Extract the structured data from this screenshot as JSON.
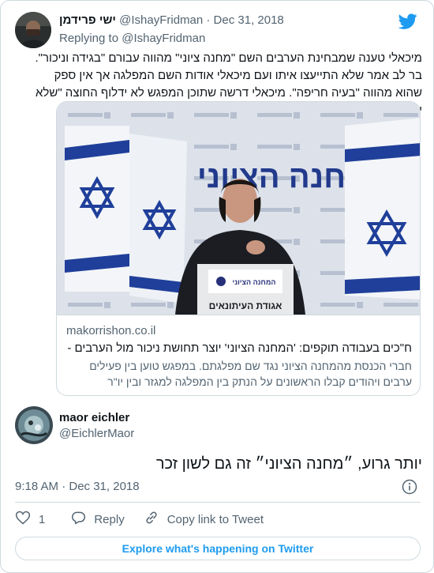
{
  "quoted_tweet": {
    "author_name": "ישי פרידמן",
    "handle_date": "@IshayFridman · Dec 31, 2018",
    "replying_to": "Replying to @IshayFridman",
    "text": "מיכאלי טענה שמבחינת הערבים השם \"מחנה ציוני\" מהווה עבורם \"בגידה וניכור\". בר לב אמר שלא התייעצו איתו ועם מיכאלי אודות השם המפלגה אך אין ספק שהוא מהווה \"בעיה חריפה\". מיכאלי דרשה שתוכן המפגש לא ידלוף החוצה \"שלא יצא שלמישהו פה יש בעיה עם השם המחנה הציוני\".",
    "link_card": {
      "domain": "makorrishon.co.il",
      "title": "ח\"כים בעבודה תוקפים: 'המחנה הציוני' יוצר תחושת ניכור מול הערבים - מ...",
      "description": "חברי הכנסת מהמחנה הציוני נגד שם מפלגתם. במפגש טוען בין פעילים ערבים ויהודים קבלו הראשונים על הנתק בין המפלגה למגזר ובין יו\"ר",
      "image_banner": "המחנה הציוני",
      "image_podium": "אגודת העיתונאים",
      "image_logo_text": "המחנה הציוני"
    }
  },
  "main_tweet": {
    "author_name": "maor eichler",
    "handle": "@EichlerMaor",
    "text": "יותר גרוע, ״מחנה הציוני״ זה גם לשון זכר",
    "timestamp": "9:18 AM · Dec 31, 2018"
  },
  "actions": {
    "like_count": "1",
    "reply_label": "Reply",
    "copy_link_label": "Copy link to Tweet"
  },
  "explore_label": "Explore what's happening on Twitter",
  "colors": {
    "accent": "#1d9bf0",
    "muted": "#536471",
    "border": "#cfd9de",
    "text": "#0f1419"
  },
  "icons": [
    "twitter-bird-icon",
    "info-icon",
    "heart-icon",
    "reply-bubble-icon",
    "link-icon"
  ]
}
